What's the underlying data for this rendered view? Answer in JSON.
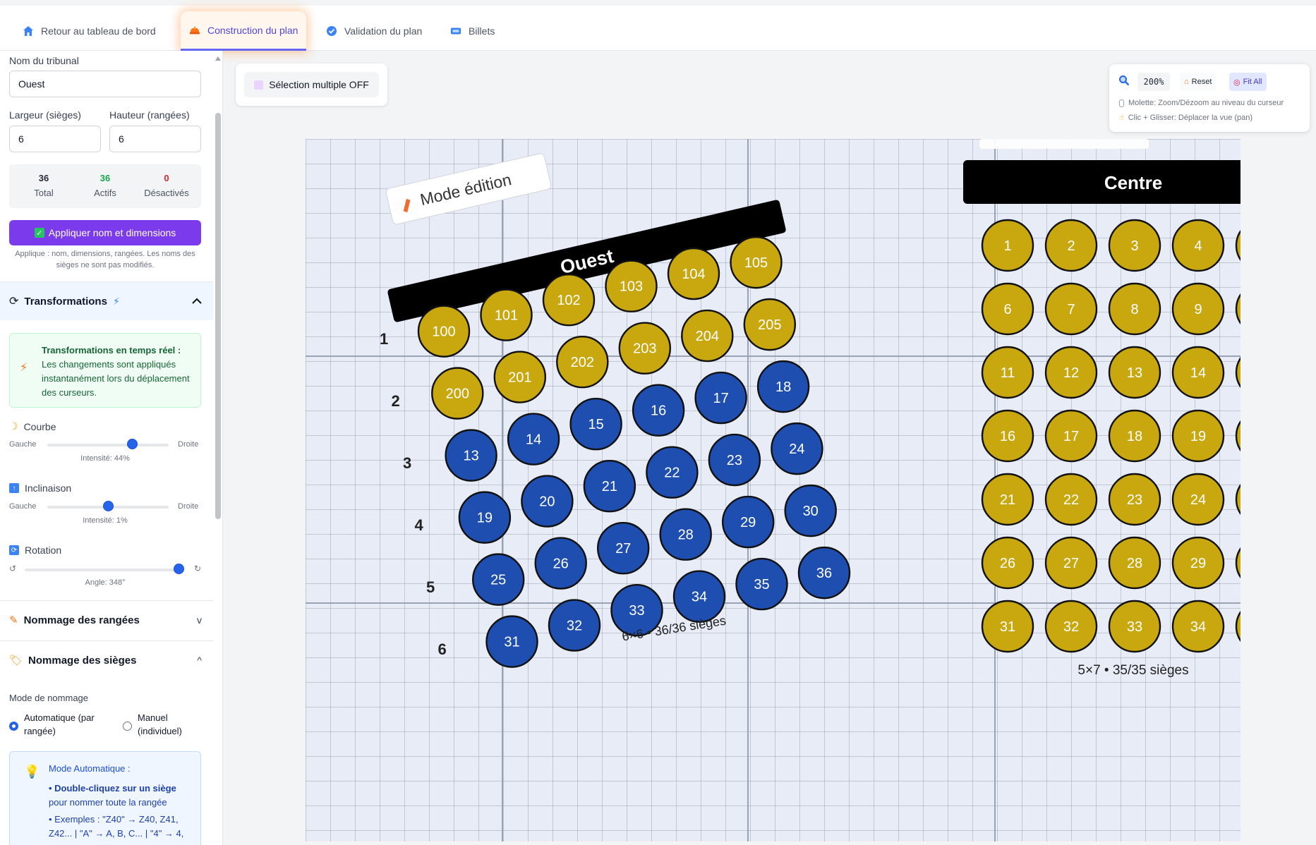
{
  "nav": {
    "tabs": [
      {
        "label": "Retour au tableau de bord",
        "icon": "home-icon"
      },
      {
        "label": "Construction du plan",
        "icon": "hardhat-icon",
        "active": true
      },
      {
        "label": "Validation du plan",
        "icon": "check-circle-icon"
      },
      {
        "label": "Billets",
        "icon": "ticket-icon"
      }
    ]
  },
  "sidebar": {
    "name_label": "Nom du tribunal",
    "name_value": "Ouest",
    "width_label": "Largeur (sièges)",
    "width_value": "6",
    "height_label": "Hauteur (rangées)",
    "height_value": "6",
    "stats": {
      "total": "36",
      "total_label": "Total",
      "active": "36",
      "active_label": "Actifs",
      "disabled": "0",
      "disabled_label": "Désactivés"
    },
    "apply_label": "Appliquer nom et dimensions",
    "apply_note": "Applique : nom, dimensions, rangées. Les noms des sièges ne sont pas modifiés.",
    "transformations": {
      "title": "Transformations",
      "realtime_title": "Transformations en temps réel :",
      "realtime_text": "Les changements sont appliqués instantanément lors du déplacement des curseurs.",
      "curve": {
        "label": "Courbe",
        "left": "Gauche",
        "right": "Droite",
        "readout": "Intensité: 44%",
        "value": 0.7
      },
      "tilt": {
        "label": "Inclinaison",
        "left": "Gauche",
        "right": "Droite",
        "readout": "Intensité: 1%",
        "value": 0.5
      },
      "rotation": {
        "label": "Rotation",
        "left": "↺",
        "right": "↻",
        "readout": "Angle: 348°",
        "value": 0.97
      }
    },
    "row_naming": {
      "title": "Nommage des rangées",
      "chevron": "v"
    },
    "seat_naming": {
      "title": "Nommage des sièges",
      "chevron": "^",
      "mode_label": "Mode de nommage",
      "auto_label_1": "Automatique (par",
      "auto_label_2": "rangée)",
      "manual_label_1": "Manuel",
      "manual_label_2": "(individuel)",
      "auto_box_title": "Mode Automatique :",
      "auto_tip_bold": "• Double-cliquez sur un siège",
      "auto_tip_rest": "pour nommer toute la rangée",
      "auto_examples": "• Exemples : \"Z40\" → Z40, Z41, Z42... | \"A\" → A, B, C... | \"4\" → 4,"
    }
  },
  "main": {
    "multi_select": "Sélection multiple OFF",
    "zoom": {
      "value": "200%",
      "reset": "Reset",
      "fit": "Fit All",
      "hint_wheel": "Molette: Zoom/Dézoom au niveau du curseur",
      "hint_drag": "Clic + Glisser: Déplacer la vue (pan)"
    },
    "west": {
      "name": "Ouest",
      "mode_label": "Mode édition",
      "summary": "6×6 • 36/36 sièges",
      "row_numbers": [
        "1",
        "2",
        "3",
        "4",
        "5",
        "6"
      ],
      "yellow_row1": [
        "100",
        "101",
        "102",
        "103",
        "104",
        "105"
      ],
      "yellow_row2": [
        "200",
        "201",
        "202",
        "203",
        "204",
        "205"
      ],
      "blue_seats": [
        "13",
        "14",
        "15",
        "16",
        "17",
        "18",
        "19",
        "20",
        "21",
        "22",
        "23",
        "24",
        "25",
        "26",
        "27",
        "28",
        "29",
        "30",
        "31",
        "32",
        "33",
        "34",
        "35",
        "36"
      ]
    },
    "centre": {
      "name": "Centre",
      "summary": "5×7 • 35/35 sièges",
      "seats": [
        "1",
        "2",
        "3",
        "4",
        "6",
        "7",
        "8",
        "9",
        "11",
        "12",
        "13",
        "14",
        "16",
        "17",
        "18",
        "19",
        "21",
        "22",
        "23",
        "24",
        "26",
        "27",
        "28",
        "29",
        "31",
        "32",
        "33",
        "34"
      ]
    }
  },
  "colors": {
    "accent": "#7c3aed",
    "seat_yellow": "#c9a70f",
    "seat_blue": "#1e4fb0",
    "nav_active": "#4f46e5"
  }
}
